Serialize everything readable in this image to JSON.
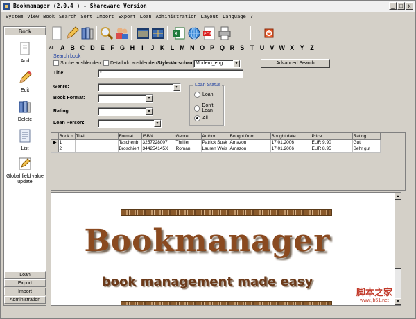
{
  "window": {
    "title": "Bookmanager (2.0.4 ) - Shareware Version",
    "controls": [
      "_",
      "□",
      "x"
    ]
  },
  "menu": [
    "System",
    "View",
    "Book",
    "Search",
    "Sort",
    "Import",
    "Export",
    "Loan",
    "Administration",
    "Layout",
    "Language",
    "?"
  ],
  "sidebar": {
    "header": "Book",
    "tools": [
      {
        "label": "Add",
        "icon": "add-book-icon"
      },
      {
        "label": "Edit",
        "icon": "edit-pencil-icon"
      },
      {
        "label": "Delete",
        "icon": "delete-books-icon"
      },
      {
        "label": "List",
        "icon": "list-document-icon"
      },
      {
        "label": "Global field value update",
        "icon": "global-update-icon"
      }
    ],
    "bottom": [
      "Loan",
      "Export",
      "Import",
      "Administration"
    ]
  },
  "toolbar": {
    "icons": [
      "new-document-icon",
      "edit-pencil-icon",
      "books-icon",
      "search-magnifier-icon",
      "users-icon",
      "grid-view-icon",
      "card-view-icon",
      "excel-export-icon",
      "web-export-icon",
      "pdf-export-icon",
      "print-icon",
      "close-app-icon"
    ]
  },
  "alphabet": {
    "all_label": "All",
    "letters": [
      "A",
      "B",
      "C",
      "D",
      "E",
      "F",
      "G",
      "H",
      "I",
      "J",
      "K",
      "L",
      "M",
      "N",
      "O",
      "P",
      "Q",
      "R",
      "S",
      "T",
      "U",
      "V",
      "W",
      "X",
      "Y",
      "Z"
    ]
  },
  "search": {
    "group_label": "Search book",
    "hide_search_label": "Suche ausblenden",
    "hide_detail_label": "Detailinfo ausblenden",
    "style_label": "Style-Vorschau:",
    "style_value": "Modern_eng",
    "advanced_button": "Advanced Search",
    "title_label": "Title:",
    "title_value": "*",
    "genre_label": "Genre:",
    "format_label": "Book Format:",
    "rating_label": "Rating:",
    "loan_person_label": "Loan Person:",
    "loan_status": {
      "title": "Loan Status",
      "options": [
        "Loan",
        "Don't Loan",
        "All"
      ],
      "selected": "All"
    }
  },
  "grid": {
    "columns": [
      "Book n",
      "Titel",
      "Format",
      "ISBN",
      "Genre",
      "Author",
      "Bought from",
      "Bought date",
      "Price",
      "Rating"
    ],
    "rows": [
      [
        "1",
        "",
        "Taschenb",
        "3257228007",
        "Thriller",
        "Patrick Susk",
        "Amazon",
        "17.01.2006",
        "EUR 9,90",
        "Gut"
      ],
      [
        "2",
        "",
        "Broschiert",
        "344254145X",
        "Roman",
        "Lauren Weis",
        "Amazon",
        "17.01.2006",
        "EUR 8,95",
        "Sehr gut"
      ]
    ],
    "current_row_marker": "▶"
  },
  "preview": {
    "title": "Bookmanager",
    "subtitle": "book management made easy"
  },
  "watermark": {
    "main": "脚本之家",
    "url": "www.jb51.net"
  }
}
